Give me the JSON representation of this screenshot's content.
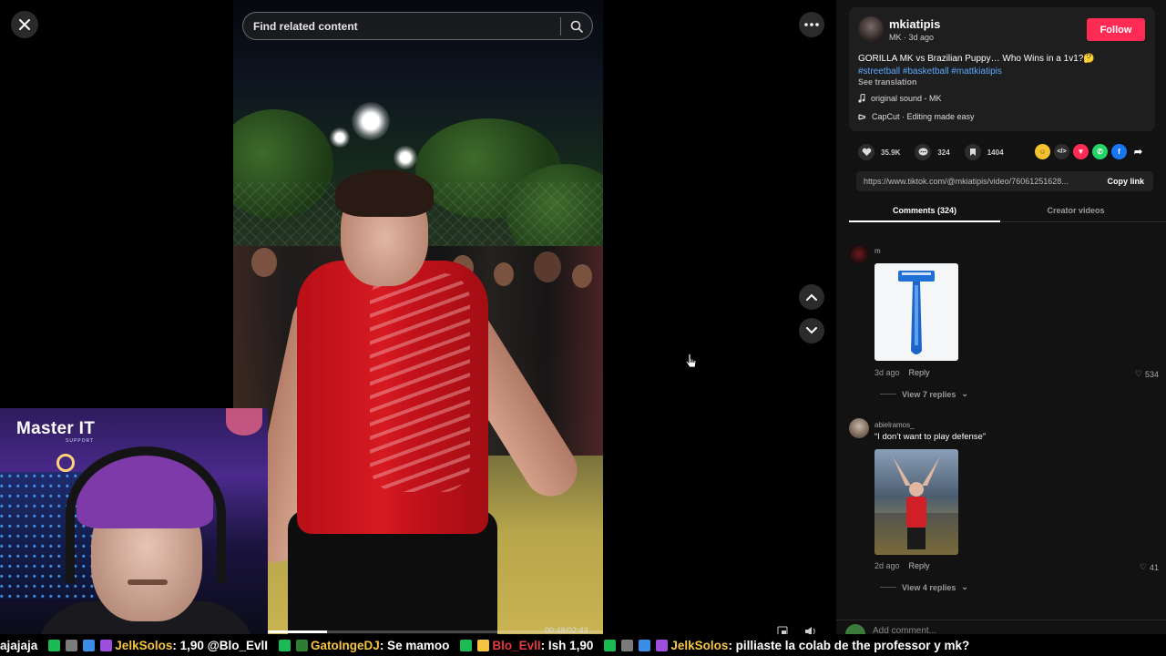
{
  "video": {
    "search_placeholder": "Find related content",
    "time": "00:48/02:43",
    "progress": 0.18
  },
  "webcam": {
    "logo": "Master IT",
    "logo_sub": "SUPPORT"
  },
  "post": {
    "author": "mkiatipis",
    "author_sub": "MK · 3d ago",
    "follow_label": "Follow",
    "caption": "GORILLA MK vs Brazilian Puppy… Who Wins in a 1v1?🤔",
    "hashtags": [
      "#streetball",
      "#basketball",
      "#mattkiatipis"
    ],
    "see_translation": "See translation",
    "sound": "original sound - MK",
    "capcut": "CapCut · Editing made easy",
    "likes": "35.9K",
    "comments": "324",
    "saves": "1404",
    "link": "https://www.tiktok.com/@mkiatipis/video/76061251628...",
    "copy_link": "Copy link"
  },
  "tabs": {
    "comments": "Comments (324)",
    "creator_videos": "Creator videos"
  },
  "comments": [
    {
      "user": "m",
      "text": "",
      "date": "3d ago",
      "reply": "Reply",
      "likes": "534",
      "view_replies": "View 7 replies"
    },
    {
      "user": "abielramos_",
      "text": "“I don’t want to play defense”",
      "date": "2d ago",
      "reply": "Reply",
      "likes": "41",
      "view_replies": "View 4 replies"
    }
  ],
  "comment_input_placeholder": "Add comment...",
  "chat": {
    "m1_tail": "ajajaja",
    "m2_user": "JelkSolos",
    "m2_text": ": 1,90 @Blo_EvlI",
    "m3_user": "GatoIngeDJ",
    "m3_text": ": Se mamoo",
    "m4_user": "Blo_EvlI",
    "m4_text": ": Ish 1,90",
    "m5_user": "JelkSolos",
    "m5_text": ": pilliaste la colab de the professor y mk?"
  },
  "colors": {
    "accent": "#fe2c55",
    "hashtag": "#5ca8ff",
    "chat_user": "#f5c542",
    "chat_user_alt": "#e53b3b"
  }
}
